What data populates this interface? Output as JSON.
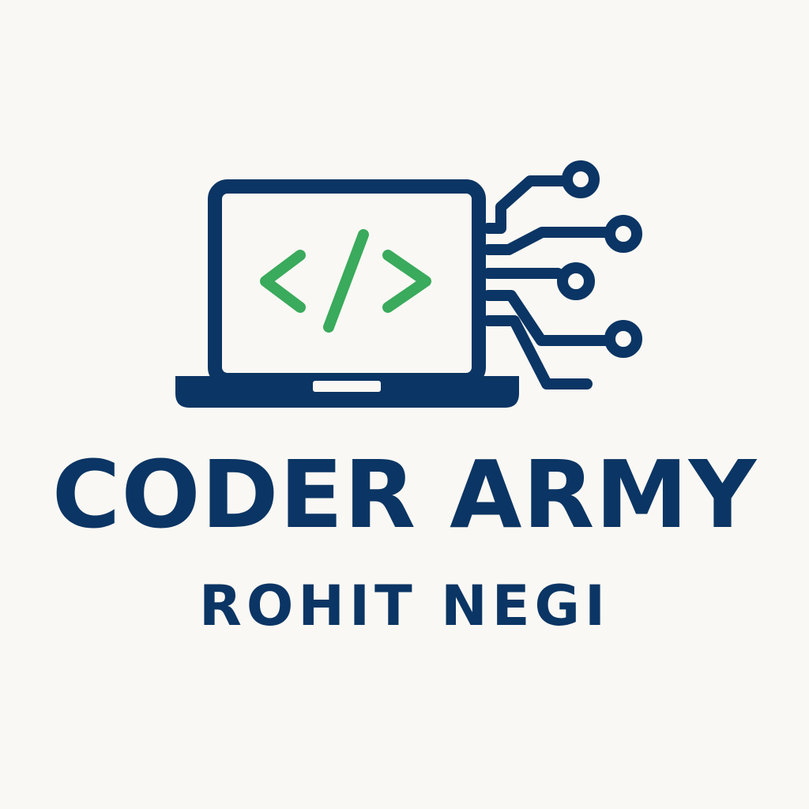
{
  "brand": {
    "title": "CODER ARMY",
    "subtitle": "ROHIT NEGI"
  },
  "logo": {
    "screen_glyph": "</>",
    "icons": [
      "laptop-icon",
      "code-brackets-icon",
      "circuit-lines-icon"
    ]
  },
  "colors": {
    "background": "#faf8f4",
    "primary": "#0b3564",
    "accent": "#3aaa5c"
  }
}
